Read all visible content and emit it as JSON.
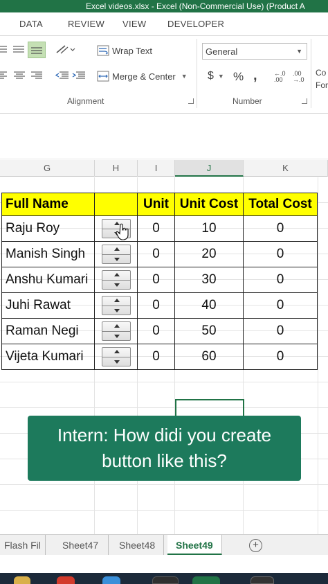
{
  "window": {
    "title": "Excel videos.xlsx -  Excel (Non-Commercial Use) (Product A"
  },
  "ribbon": {
    "tabs": [
      "DATA",
      "REVIEW",
      "VIEW",
      "DEVELOPER"
    ],
    "alignment": {
      "wrap_text": "Wrap Text",
      "merge_center": "Merge & Center",
      "group_label": "Alignment"
    },
    "number": {
      "format_value": "General",
      "currency": "$",
      "percent": "%",
      "comma": ",",
      "inc_decimal": "←.0 .00",
      "dec_decimal": ".00 →.0",
      "group_label": "Number"
    },
    "styles_partial": {
      "line1": "Co",
      "line2": "For"
    }
  },
  "columns": [
    "G",
    "H",
    "I",
    "J",
    "K"
  ],
  "active_column": "J",
  "table": {
    "headers": [
      "Full Name",
      "",
      "Unit",
      "Unit Cost",
      "Total Cost"
    ],
    "rows": [
      {
        "name": "Raju Roy",
        "unit": "0",
        "unit_cost": "10",
        "total_cost": "0"
      },
      {
        "name": "Manish Singh",
        "unit": "0",
        "unit_cost": "20",
        "total_cost": "0"
      },
      {
        "name": "Anshu Kumari",
        "unit": "0",
        "unit_cost": "30",
        "total_cost": "0"
      },
      {
        "name": "Juhi Rawat",
        "unit": "0",
        "unit_cost": "40",
        "total_cost": "0"
      },
      {
        "name": "Raman Negi",
        "unit": "0",
        "unit_cost": "50",
        "total_cost": "0"
      },
      {
        "name": "Vijeta Kumari",
        "unit": "0",
        "unit_cost": "60",
        "total_cost": "0"
      }
    ]
  },
  "caption": {
    "line1": "Intern: How didi you create",
    "line2": "button like this?"
  },
  "sheet_tabs": [
    "Flash Fil",
    "Sheet47",
    "Sheet48",
    "Sheet49"
  ],
  "active_sheet": "Sheet49",
  "colors": {
    "excel_green": "#217346",
    "header_yellow": "#ffff00",
    "caption_bg": "#1d7a5c"
  }
}
